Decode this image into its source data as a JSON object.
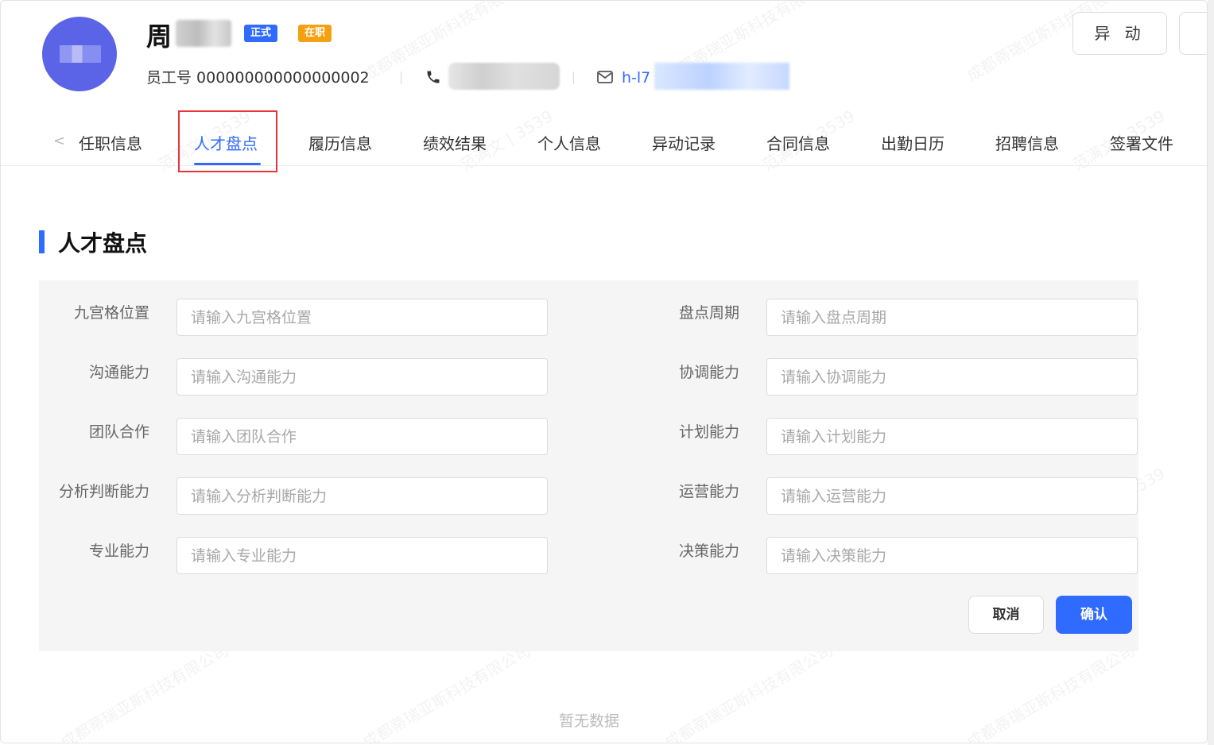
{
  "header": {
    "name": "周",
    "tags": [
      "正式",
      "在职"
    ],
    "employee_id": "员工号 000000000000000002",
    "email_prefix": "h-l7",
    "action_button": "异 动"
  },
  "tabs": [
    "任职信息",
    "人才盘点",
    "履历信息",
    "绩效结果",
    "个人信息",
    "异动记录",
    "合同信息",
    "出勤日历",
    "招聘信息",
    "签署文件"
  ],
  "active_tab": "人才盘点",
  "section": {
    "title": "人才盘点"
  },
  "form": {
    "left": [
      {
        "label": "九宫格位置",
        "placeholder": "请输入九宫格位置"
      },
      {
        "label": "沟通能力",
        "placeholder": "请输入沟通能力"
      },
      {
        "label": "团队合作",
        "placeholder": "请输入团队合作"
      },
      {
        "label": "分析判断能力",
        "placeholder": "请输入分析判断能力"
      },
      {
        "label": "专业能力",
        "placeholder": "请输入专业能力"
      }
    ],
    "right": [
      {
        "label": "盘点周期",
        "placeholder": "请输入盘点周期"
      },
      {
        "label": "协调能力",
        "placeholder": "请输入协调能力"
      },
      {
        "label": "计划能力",
        "placeholder": "请输入计划能力"
      },
      {
        "label": "运营能力",
        "placeholder": "请输入运营能力"
      },
      {
        "label": "决策能力",
        "placeholder": "请输入决策能力"
      }
    ],
    "cancel_label": "取消",
    "confirm_label": "确认"
  },
  "empty_text": "暂无数据",
  "watermark_text": "成都蒂瑞亚斯科技有限公司",
  "watermark_text_2": "范满文 | 3539",
  "colors": {
    "primary": "#2f6bff",
    "tag_orange": "#f5a011",
    "highlight_red": "#e8333a"
  }
}
